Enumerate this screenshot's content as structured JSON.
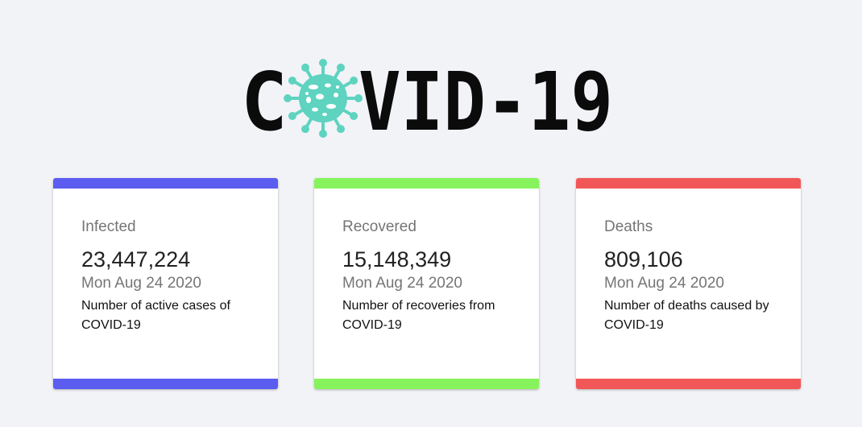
{
  "logo": {
    "text_left": "C",
    "text_right": "VID-19",
    "virus_color": "#5ed3c0",
    "text_color": "#0b0b0b"
  },
  "cards": [
    {
      "title": "Infected",
      "value": "23,447,224",
      "date": "Mon Aug 24 2020",
      "description": "Number of active cases of COVID-19",
      "accent": "#5b5cf0"
    },
    {
      "title": "Recovered",
      "value": "15,148,349",
      "date": "Mon Aug 24 2020",
      "description": "Number of recoveries from COVID-19",
      "accent": "#87f35c"
    },
    {
      "title": "Deaths",
      "value": "809,106",
      "date": "Mon Aug 24 2020",
      "description": "Number of deaths caused by COVID-19",
      "accent": "#f25757"
    }
  ]
}
